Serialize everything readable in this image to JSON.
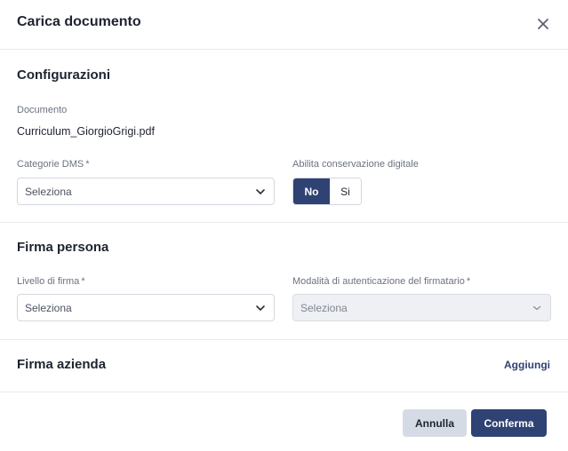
{
  "header": {
    "title": "Carica documento"
  },
  "configurazioni": {
    "title": "Configurazioni",
    "document_label": "Documento",
    "document_value": "Curriculum_GiorgioGrigi.pdf",
    "dms_label": "Categorie DMS",
    "required_mark": "*",
    "dms_placeholder": "Seleziona",
    "conservazione_label": "Abilita conservazione digitale",
    "toggle_no": "No",
    "toggle_si": "Si",
    "toggle_selected": "No"
  },
  "firma_persona": {
    "title": "Firma persona",
    "livello_label": "Livello di firma",
    "livello_placeholder": "Seleziona",
    "modalita_label": "Modalità di autenticazione del firmatario",
    "modalita_placeholder": "Seleziona"
  },
  "firma_azienda": {
    "title": "Firma azienda",
    "add_link": "Aggiungi"
  },
  "footer": {
    "cancel_label": "Annulla",
    "confirm_label": "Conferma"
  },
  "colors": {
    "primary": "#2e4373",
    "secondary_button": "#d5dbe4",
    "disabled_field": "#eef0f3"
  }
}
